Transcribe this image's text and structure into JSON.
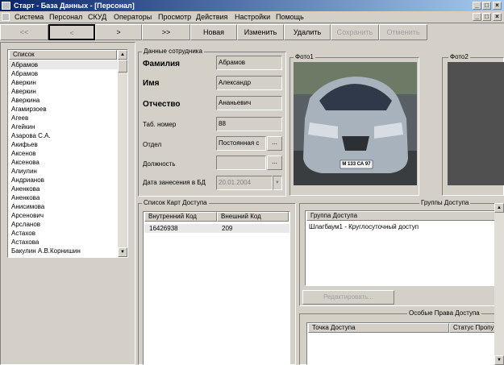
{
  "window": {
    "title": "Старт - База Данных - [Персонал]"
  },
  "menu": [
    "Система",
    "Персонал",
    "СКУД",
    "Операторы",
    "Просмотр",
    "Действия",
    "Настройки",
    "Помощь"
  ],
  "toolbar": {
    "first": "<<",
    "prev": "<",
    "next": ">",
    "last": ">>",
    "new": "Новая",
    "edit": "Изменить",
    "delete": "Удалить",
    "save": "Сохранить",
    "cancel": "Отменить"
  },
  "list": {
    "header": "Список",
    "items": [
      "Абрамов",
      "Абрамов",
      "Аверкин",
      "Аверкин",
      "Аверкина",
      "Агамирзоев",
      "Агеев",
      "Агейкин",
      "Азарова С.А.",
      "Акифьев",
      "Аксенов",
      "Аксенова",
      "Алиулин",
      "Андрианов",
      "Аненкова",
      "Аненкова",
      "Анисимова",
      "Арсенович",
      "Арсланов",
      "Астахов",
      "Астахова",
      "Бакулин А.В.Корнишин"
    ]
  },
  "employee": {
    "section": "Данные сотрудника",
    "surname_label": "Фамилия",
    "surname": "Абрамов",
    "name_label": "Имя",
    "name": "Александр",
    "patronymic_label": "Отчество",
    "patronymic": "Ананьевич",
    "tab_label": "Таб. номер",
    "tab": "88",
    "dept_label": "Отдел",
    "dept": "Постоянная с",
    "position_label": "Должность",
    "position": "",
    "date_label": "Дата занесения в БД",
    "date": "20.01.2004"
  },
  "photo1": {
    "label": "Фото1",
    "plate": "М 133 СА 97"
  },
  "photo2": {
    "label": "Фото2"
  },
  "cards": {
    "section": "Список Карт Доступа",
    "col_internal": "Внутренний Код",
    "col_external": "Внешний Код",
    "rows": [
      {
        "internal": "16426938",
        "external": "209"
      }
    ]
  },
  "groups": {
    "section": "Группы Доступа",
    "col": "Группа Доступа",
    "rows": [
      "Шлагбаум1 - Круглосуточный доступ"
    ],
    "edit_button": "Редактировать..."
  },
  "special": {
    "section": "Особые Права Доступа",
    "col_point": "Точка Доступа",
    "col_status": "Статус Пропу"
  }
}
